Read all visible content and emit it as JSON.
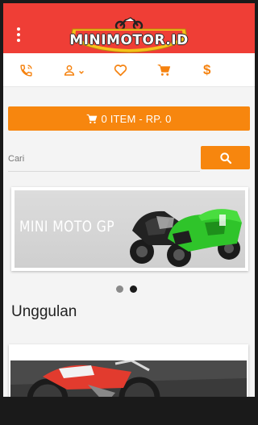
{
  "brand": {
    "logo_text": "MINIMOTOR.ID",
    "primary_color": "#ef3e36",
    "accent_color": "#f7860e"
  },
  "header": {
    "menu_icon": "kebab-menu-icon"
  },
  "iconbar": {
    "items": [
      {
        "icon": "phone-icon"
      },
      {
        "icon": "user-icon",
        "has_dropdown": true
      },
      {
        "icon": "heart-icon"
      },
      {
        "icon": "cart-icon"
      },
      {
        "icon": "dollar-icon",
        "label": "$"
      }
    ]
  },
  "cart": {
    "label": "0 ITEM - RP. 0",
    "icon": "cart-icon"
  },
  "search": {
    "placeholder": "Cari",
    "button_icon": "search-icon"
  },
  "slider": {
    "caption": "MINI MOTO GP",
    "dots": [
      {
        "active": false
      },
      {
        "active": true
      }
    ]
  },
  "featured": {
    "title": "Unggulan"
  }
}
